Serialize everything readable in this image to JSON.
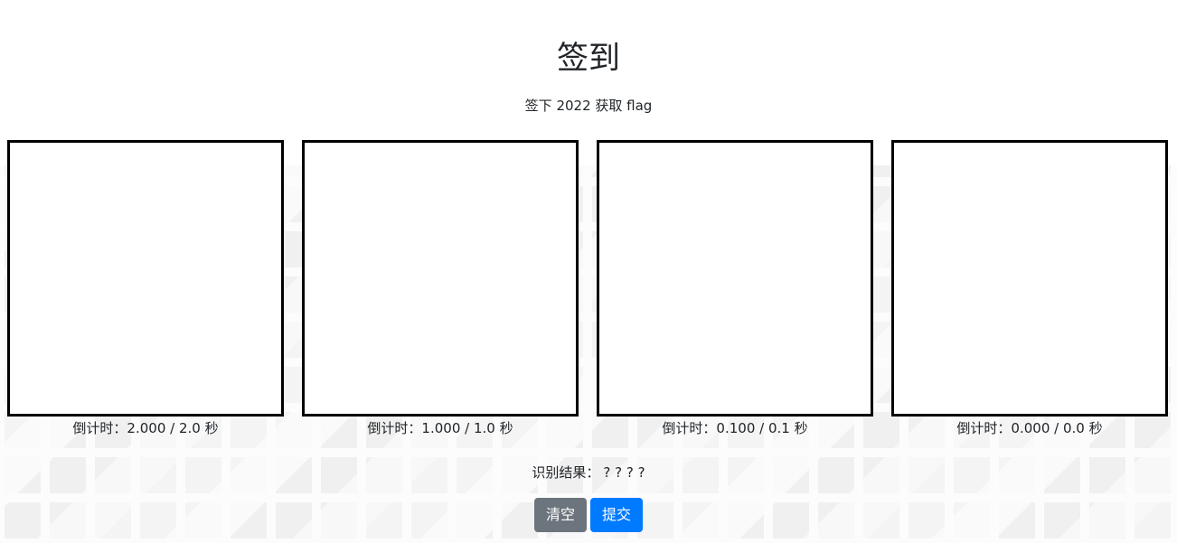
{
  "header": {
    "title": "签到",
    "subtitle": "签下 2022 获取 flag"
  },
  "canvases": [
    {
      "countdown": "倒计时：2.000 / 2.0 秒"
    },
    {
      "countdown": "倒计时：1.000 / 1.0 秒"
    },
    {
      "countdown": "倒计时：0.100 / 0.1 秒"
    },
    {
      "countdown": "倒计时：0.000 / 0.0 秒"
    }
  ],
  "result": {
    "label": "识别结果：",
    "value": "? ? ? ?"
  },
  "actions": {
    "clear_label": "清空",
    "submit_label": "提交"
  },
  "colors": {
    "secondary_button": "#6c757d",
    "primary_button": "#007bff",
    "canvas_border": "#000000"
  }
}
